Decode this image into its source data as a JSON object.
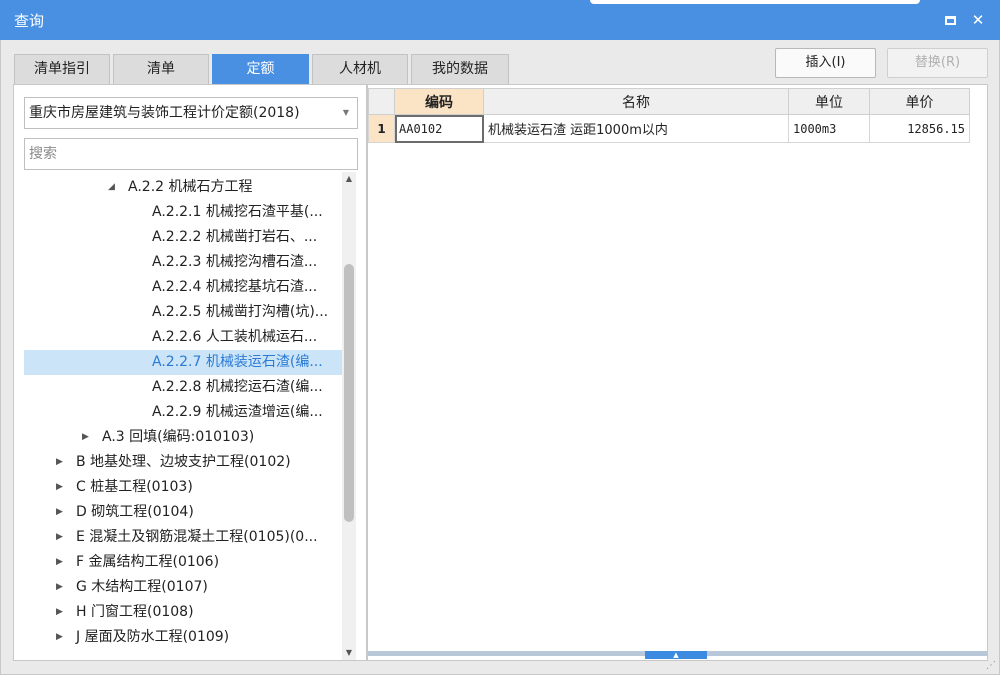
{
  "window": {
    "title": "查询"
  },
  "tabs": [
    {
      "label": "清单指引",
      "active": false
    },
    {
      "label": "清单",
      "active": false
    },
    {
      "label": "定额",
      "active": true
    },
    {
      "label": "人材机",
      "active": false
    },
    {
      "label": "我的数据",
      "active": false
    }
  ],
  "toolbar": {
    "insert_label": "插入(I)",
    "replace_label": "替换(R)"
  },
  "left": {
    "library_select": "重庆市房屋建筑与装饰工程计价定额(2018)",
    "search_placeholder": "搜索",
    "tree": [
      {
        "label": "A.2.2 机械石方工程",
        "level": 3,
        "expander": "expanded",
        "selected": false
      },
      {
        "label": "A.2.2.1 机械挖石渣平基(...",
        "level": 4,
        "expander": "none",
        "selected": false
      },
      {
        "label": "A.2.2.2 机械凿打岩石、...",
        "level": 4,
        "expander": "none",
        "selected": false
      },
      {
        "label": "A.2.2.3 机械挖沟槽石渣...",
        "level": 4,
        "expander": "none",
        "selected": false
      },
      {
        "label": "A.2.2.4 机械挖基坑石渣...",
        "level": 4,
        "expander": "none",
        "selected": false
      },
      {
        "label": "A.2.2.5 机械凿打沟槽(坑)...",
        "level": 4,
        "expander": "none",
        "selected": false
      },
      {
        "label": "A.2.2.6 人工装机械运石...",
        "level": 4,
        "expander": "none",
        "selected": false
      },
      {
        "label": "A.2.2.7 机械装运石渣(编...",
        "level": 4,
        "expander": "none",
        "selected": true
      },
      {
        "label": "A.2.2.8 机械挖运石渣(编...",
        "level": 4,
        "expander": "none",
        "selected": false
      },
      {
        "label": "A.2.2.9 机械运渣增运(编...",
        "level": 4,
        "expander": "none",
        "selected": false
      },
      {
        "label": "A.3 回填(编码:010103)",
        "level": 2,
        "expander": "collapsed",
        "selected": false
      },
      {
        "label": "B 地基处理、边坡支护工程(0102)",
        "level": 1,
        "expander": "collapsed",
        "selected": false
      },
      {
        "label": "C 桩基工程(0103)",
        "level": 1,
        "expander": "collapsed",
        "selected": false
      },
      {
        "label": "D 砌筑工程(0104)",
        "level": 1,
        "expander": "collapsed",
        "selected": false
      },
      {
        "label": "E 混凝土及钢筋混凝土工程(0105)(0...",
        "level": 1,
        "expander": "collapsed",
        "selected": false
      },
      {
        "label": "F 金属结构工程(0106)",
        "level": 1,
        "expander": "collapsed",
        "selected": false
      },
      {
        "label": "G 木结构工程(0107)",
        "level": 1,
        "expander": "collapsed",
        "selected": false
      },
      {
        "label": "H 门窗工程(0108)",
        "level": 1,
        "expander": "collapsed",
        "selected": false
      },
      {
        "label": "J 屋面及防水工程(0109)",
        "level": 1,
        "expander": "collapsed",
        "selected": false
      }
    ]
  },
  "grid": {
    "columns": [
      "编码",
      "名称",
      "单位",
      "单价"
    ],
    "rows": [
      {
        "num": "1",
        "code": "AA0102",
        "name": "机械装运石渣 运距1000m以内",
        "unit": "1000m3",
        "price": "12856.15"
      }
    ]
  },
  "icons": {
    "maximize": "maximize-icon",
    "close": "close-icon",
    "dropdown": "chevron-down-icon",
    "expanded": "triangle-down-right-icon",
    "collapsed": "triangle-right-icon"
  }
}
